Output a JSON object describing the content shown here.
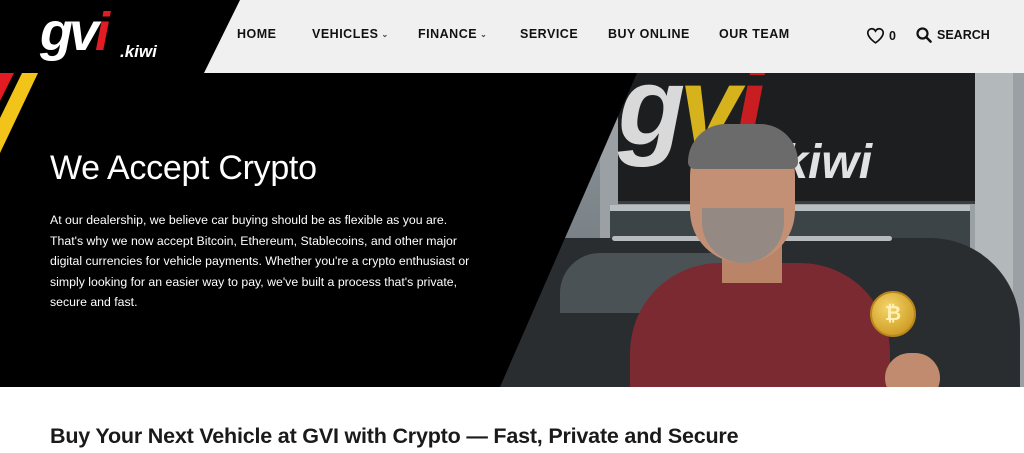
{
  "logo": {
    "brand": "gvi",
    "domain": ".kiwi"
  },
  "nav": {
    "items": [
      {
        "label": "HOME",
        "dropdown": false
      },
      {
        "label": "VEHICLES",
        "dropdown": true
      },
      {
        "label": "FINANCE",
        "dropdown": true
      },
      {
        "label": "SERVICE",
        "dropdown": false
      },
      {
        "label": "BUY ONLINE",
        "dropdown": false
      },
      {
        "label": "OUR TEAM",
        "dropdown": false
      }
    ],
    "favourites_count": "0",
    "search_label": "SEARCH"
  },
  "hero": {
    "title": "We Accept Crypto",
    "body": "At our dealership, we believe car buying should be as flexible as you are. That's why we now accept Bitcoin, Ethereum, Stablecoins, and other major digital currencies for vehicle payments. Whether you're a crypto enthusiast or simply looking for an easier way to pay, we've built a process that's private, secure and fast.",
    "sign_brand": "gvi",
    "sign_domain": ".kiwi",
    "coin_symbol": "₿"
  },
  "section": {
    "heading": "Buy Your Next Vehicle at GVI with Crypto — Fast, Private and Secure"
  },
  "colors": {
    "accent_red": "#e31b23",
    "accent_yellow": "#f2c318",
    "header_bg": "#f0f0f0",
    "hero_panel": "#000000"
  },
  "icons": {
    "favourites": "heart-icon",
    "search": "search-icon",
    "dropdown": "chevron-down-icon"
  }
}
